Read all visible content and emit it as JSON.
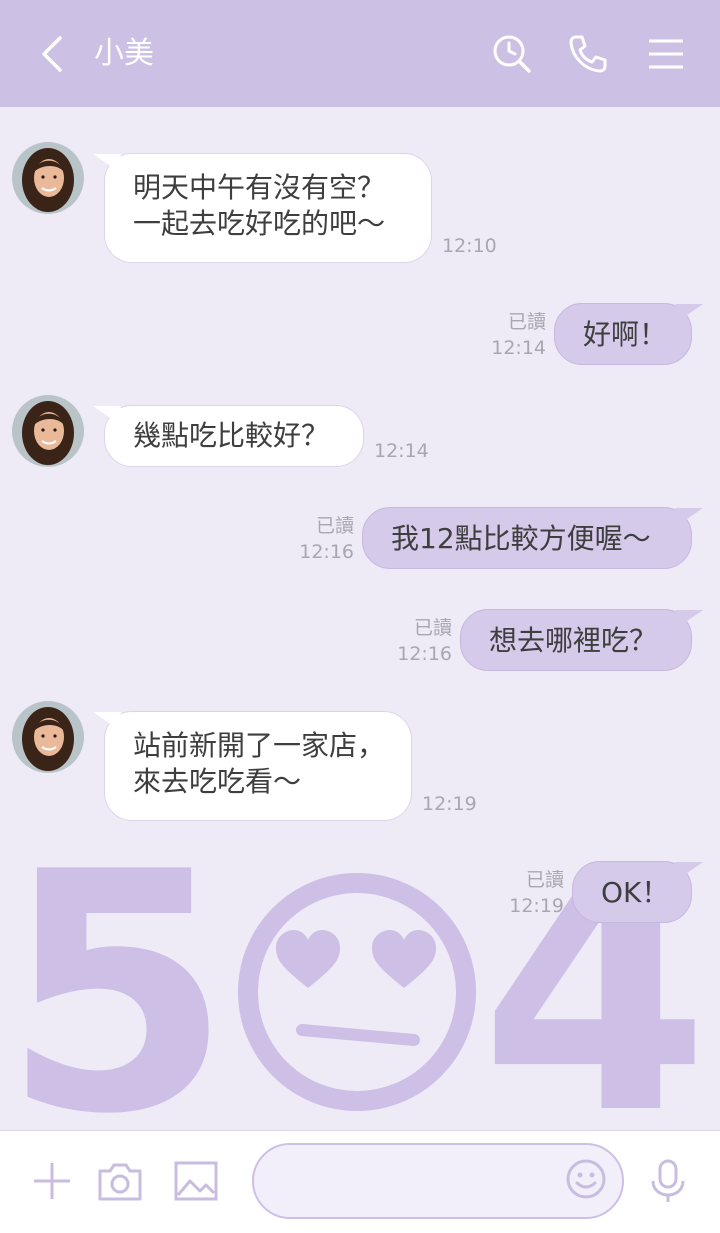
{
  "header": {
    "contact_name": "小美",
    "icons": [
      "back-icon",
      "search-history-icon",
      "phone-icon",
      "menu-icon"
    ]
  },
  "background_art": {
    "text_left": "5",
    "text_right": "4",
    "emoji": "heart-eyes-face"
  },
  "messages": [
    {
      "side": "in",
      "lines": [
        "明天中午有沒有空？",
        "一起去吃好吃的吧～"
      ],
      "time": "12:10"
    },
    {
      "side": "out",
      "text": "好啊！",
      "read": "已讀",
      "time": "12:14"
    },
    {
      "side": "in",
      "lines": [
        "幾點吃比較好？"
      ],
      "time": "12:14"
    },
    {
      "side": "out",
      "text": "我12點比較方便喔～",
      "read": "已讀",
      "time": "12:16"
    },
    {
      "side": "out",
      "text": "想去哪裡吃？",
      "read": "已讀",
      "time": "12:16"
    },
    {
      "side": "in",
      "lines": [
        "站前新開了一家店，",
        "來去吃吃看～"
      ],
      "time": "12:19"
    },
    {
      "side": "out",
      "text": "OK！",
      "read": "已讀",
      "time": "12:19"
    }
  ],
  "input": {
    "placeholder": ""
  },
  "colors": {
    "header": "#cdc0e5",
    "background": "#eeeaf6",
    "bubble_out": "#d6caea",
    "bubble_in": "#ffffff",
    "decor": "#cdbfe5"
  }
}
